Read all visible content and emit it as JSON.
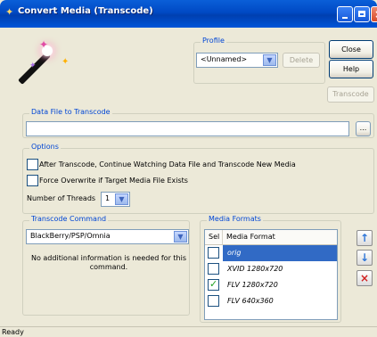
{
  "window": {
    "title": "Convert Media (Transcode)"
  },
  "profile": {
    "legend": "Profile",
    "selected": "<Unnamed>",
    "delete_label": "Delete"
  },
  "buttons": {
    "close": "Close",
    "help": "Help",
    "transcode": "Transcode"
  },
  "data_file": {
    "legend": "Data File to Transcode",
    "value": "",
    "browse": "..."
  },
  "options": {
    "legend": "Options",
    "continue_label": "After Transcode, Continue Watching Data File and Transcode New Media",
    "continue_checked": false,
    "overwrite_label": "Force Overwrite if Target Media File Exists",
    "overwrite_checked": false,
    "threads_label": "Number of Threads",
    "threads_value": "1"
  },
  "transcode_command": {
    "legend": "Transcode Command",
    "selected": "BlackBerry/PSP/Omnia",
    "info": "No additional information is needed for this command."
  },
  "media_formats": {
    "legend": "Media Formats",
    "columns": [
      "Sel",
      "Media Format"
    ],
    "rows": [
      {
        "format": "orig",
        "checked": false,
        "selected": true
      },
      {
        "format": "XVID 1280x720",
        "checked": false,
        "selected": false
      },
      {
        "format": "FLV 1280x720",
        "checked": true,
        "selected": false
      },
      {
        "format": "FLV 640x360",
        "checked": false,
        "selected": false
      }
    ]
  },
  "status_bar": {
    "text": "Ready"
  },
  "icons": {
    "app": "wand-icon",
    "up": "arrow-up-icon",
    "down": "arrow-down-icon",
    "remove": "remove-icon"
  }
}
